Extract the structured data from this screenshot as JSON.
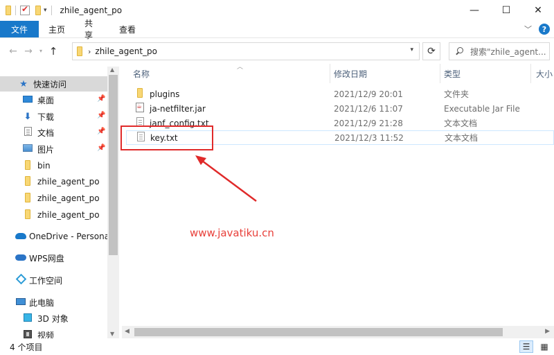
{
  "window": {
    "title": "zhile_agent_po",
    "minimize": "—",
    "maximize": "☐",
    "close": "✕"
  },
  "ribbon": {
    "tabs": [
      {
        "label": "文件"
      },
      {
        "label": "主页"
      },
      {
        "label": "共享"
      },
      {
        "label": "查看"
      }
    ],
    "help": "?"
  },
  "address": {
    "crumbs": [
      "zhile_agent_po"
    ],
    "search_placeholder": "搜索\"zhile_agent..."
  },
  "nav": {
    "items": [
      {
        "label": "快速访问",
        "icon": "star-icon"
      },
      {
        "label": "桌面",
        "icon": "desktop-icon",
        "pinned": true
      },
      {
        "label": "下载",
        "icon": "download-icon",
        "pinned": true
      },
      {
        "label": "文档",
        "icon": "documents-icon",
        "pinned": true
      },
      {
        "label": "图片",
        "icon": "pictures-icon",
        "pinned": true
      },
      {
        "label": "bin",
        "icon": "folder-icon"
      },
      {
        "label": "zhile_agent_po",
        "icon": "folder-icon"
      },
      {
        "label": "zhile_agent_po",
        "icon": "folder-icon"
      },
      {
        "label": "zhile_agent_po",
        "icon": "folder-icon"
      },
      {
        "label": "OneDrive - Personal",
        "icon": "onedrive-icon"
      },
      {
        "label": "WPS网盘",
        "icon": "wps-cloud-icon"
      },
      {
        "label": "工作空间",
        "icon": "workspace-icon"
      },
      {
        "label": "此电脑",
        "icon": "this-pc-icon"
      },
      {
        "label": "3D 对象",
        "icon": "3d-objects-icon"
      },
      {
        "label": "视频",
        "icon": "videos-icon"
      }
    ]
  },
  "files": {
    "columns": {
      "name": "名称",
      "date": "修改日期",
      "type": "类型",
      "size": "大小"
    },
    "rows": [
      {
        "name": "plugins",
        "date": "2021/12/9 20:01",
        "type": "文件夹",
        "icon": "folder-icon"
      },
      {
        "name": "ja-netfilter.jar",
        "date": "2021/12/6 11:07",
        "type": "Executable Jar File",
        "icon": "jar-icon"
      },
      {
        "name": "janf_config.txt",
        "date": "2021/12/9 21:28",
        "type": "文本文档",
        "icon": "text-file-icon"
      },
      {
        "name": "key.txt",
        "date": "2021/12/3 11:52",
        "type": "文本文档",
        "icon": "text-file-icon"
      }
    ]
  },
  "watermark": "www.javatiku.cn",
  "status": {
    "item_count": "4 个项目"
  },
  "colors": {
    "accent": "#1979ca",
    "annotation": "#e02a2a"
  }
}
